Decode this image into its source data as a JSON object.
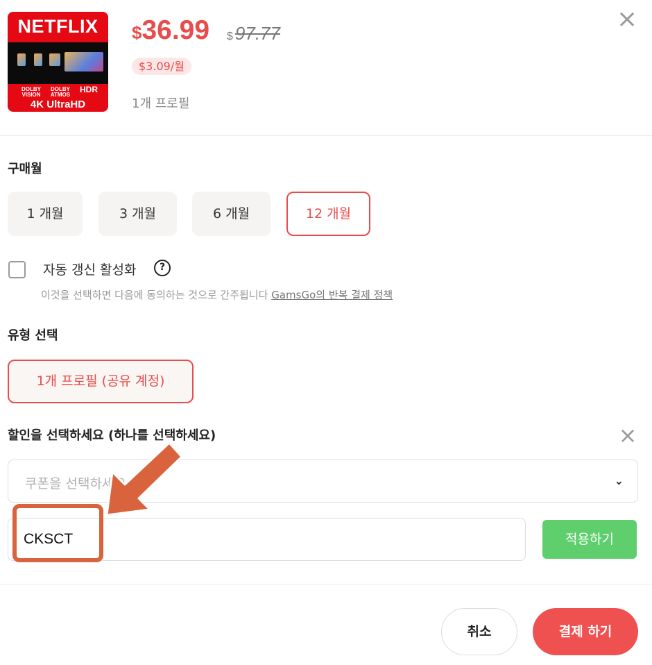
{
  "product": {
    "thumbnail": {
      "brand": "NETFLIX",
      "formats": [
        "DOLBY VISION",
        "DOLBY ATMOS",
        "HDR"
      ],
      "resolution": "4K UltraHD"
    },
    "price": {
      "currency": "$",
      "value": "36.99"
    },
    "original_price": {
      "currency": "$",
      "value": "97.77"
    },
    "monthly_price": "$3.09/월",
    "profile_count": "1개 프로필"
  },
  "close_icon": "close-icon",
  "purchase_month": {
    "title": "구매월",
    "options": [
      "1 개월",
      "3 개월",
      "6 개월",
      "12 개월"
    ],
    "selected": "12 개월"
  },
  "auto_renew": {
    "label": "자동 갱신 활성화",
    "checked": false,
    "help_icon": "question-circle-icon",
    "help_glyph": "?",
    "notice": "이것을 선택하면 다음에 동의하는 것으로 간주됩니다",
    "policy_link": "GamsGo의 반복 결제 정책"
  },
  "type": {
    "title": "유형 선택",
    "option": "1개 프로필 (공유 계정)"
  },
  "discount": {
    "title": "할인을 선택하세요 (하나를 선택하세요)",
    "coupon_placeholder": "쿠폰을 선택하세요",
    "code_value": "CKSCT",
    "apply_label": "적용하기"
  },
  "footer": {
    "cancel_label": "취소",
    "pay_label": "결제 하기"
  },
  "colors": {
    "accent": "#e84c4c",
    "apply": "#5fcf6e",
    "pay": "#ef5150",
    "annotation": "#d8633c"
  }
}
